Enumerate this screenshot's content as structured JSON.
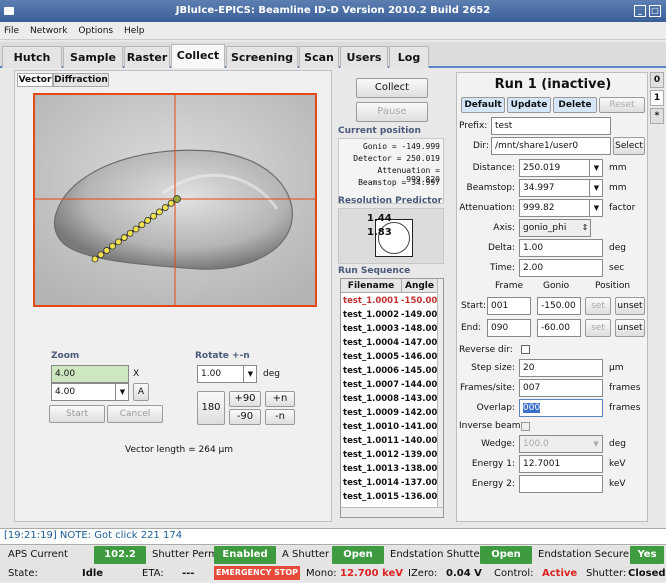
{
  "window": {
    "title": "JBluIce-EPICS: Beamline ID-D Version 2010.2 Build 2652"
  },
  "menu": [
    "File",
    "Network",
    "Options",
    "Help"
  ],
  "tabs": [
    "Hutch",
    "Sample",
    "Raster",
    "Collect",
    "Screening",
    "Scan",
    "Users",
    "Log"
  ],
  "left": {
    "subtabs": [
      "Vector",
      "Diffraction"
    ],
    "zoom": {
      "label": "Zoom",
      "value1": "4.00",
      "unit": "X",
      "value2": "4.00",
      "a_label": "A",
      "start": "Start",
      "cancel": "Cancel"
    },
    "rotate": {
      "label": "Rotate +-n",
      "value": "1.00",
      "unit": "deg",
      "b180": "180",
      "p90": "+90",
      "m90": "-90",
      "pn": "+n",
      "mn": "-n"
    },
    "vector_length": "Vector length = 264 µm"
  },
  "mid": {
    "collect": "Collect",
    "pause": "Pause",
    "current_position": "Current position",
    "pos": [
      "Gonio = -149.999",
      "Detector = 250.019",
      "Attenuation = 999.820",
      "Beamstop = 34.997"
    ],
    "res_title": "Resolution Predictor",
    "res1": "1.44",
    "res2": "1.83",
    "run_seq": "Run Sequence",
    "col_filename": "Filename",
    "col_angle": "Angle",
    "rows": [
      [
        "test_1.0001",
        "-150.00"
      ],
      [
        "test_1.0002",
        "-149.00"
      ],
      [
        "test_1.0003",
        "-148.00"
      ],
      [
        "test_1.0004",
        "-147.00"
      ],
      [
        "test_1.0005",
        "-146.00"
      ],
      [
        "test_1.0006",
        "-145.00"
      ],
      [
        "test_1.0007",
        "-144.00"
      ],
      [
        "test_1.0008",
        "-143.00"
      ],
      [
        "test_1.0009",
        "-142.00"
      ],
      [
        "test_1.0010",
        "-141.00"
      ],
      [
        "test_1.0011",
        "-140.00"
      ],
      [
        "test_1.0012",
        "-139.00"
      ],
      [
        "test_1.0013",
        "-138.00"
      ],
      [
        "test_1.0014",
        "-137.00"
      ],
      [
        "test_1.0015",
        "-136.00"
      ]
    ]
  },
  "run": {
    "title": "Run 1 (inactive)",
    "default": "Default",
    "update": "Update",
    "delete": "Delete",
    "reset": "Reset",
    "side": [
      "0",
      "1",
      "*"
    ],
    "prefix_label": "Prefix:",
    "prefix": "test",
    "dir_label": "Dir:",
    "dir": "/mnt/share1/user0",
    "select": "Select",
    "distance_label": "Distance:",
    "distance": "250.019",
    "distance_unit": "mm",
    "beamstop_label": "Beamstop:",
    "beamstop": "34.997",
    "beamstop_unit": "mm",
    "atten_label": "Attenuation:",
    "atten": "999.82",
    "atten_unit": "factor",
    "axis_label": "Axis:",
    "axis": "gonio_phi",
    "delta_label": "Delta:",
    "delta": "1.00",
    "delta_unit": "deg",
    "time_label": "Time:",
    "time": "2.00",
    "time_unit": "sec",
    "h_frame": "Frame",
    "h_gonio": "Gonio",
    "h_position": "Position",
    "start_label": "Start:",
    "start_frame": "001",
    "start_gonio": "-150.00",
    "set": "set",
    "unset": "unset",
    "end_label": "End:",
    "end_frame": "090",
    "end_gonio": "-60.00",
    "reverse_label": "Reverse dir:",
    "stepsize_label": "Step size:",
    "stepsize": "20",
    "stepsize_unit": "µm",
    "frames_label": "Frames/site:",
    "frames": "007",
    "frames_unit": "frames",
    "overlap_label": "Overlap:",
    "overlap": "000",
    "overlap_unit": "frames",
    "inverse_label": "Inverse beam",
    "wedge_label": "Wedge:",
    "wedge": "100.0",
    "wedge_unit": "deg",
    "e1_label": "Energy 1:",
    "e1": "12.7001",
    "e1_unit": "keV",
    "e2_label": "Energy 2:",
    "e2": "",
    "e2_unit": "keV"
  },
  "log": "[19:21:19] NOTE: Got click 221 174",
  "status1": {
    "aps_label": "APS Current",
    "aps": "102.2",
    "shutter_label": "Shutter Permit",
    "shutter": "Enabled",
    "ashutter_label": "A Shutter",
    "ashutter": "Open",
    "end_label": "Endstation Shutter",
    "end": "Open",
    "secure_label": "Endstation Secure",
    "secure": "Yes"
  },
  "status2": {
    "state_label": "State:",
    "state": "Idle",
    "eta_label": "ETA:",
    "eta": "---",
    "estop": "EMERGENCY STOP",
    "mono_label": "Mono:",
    "mono": "12.700 keV",
    "izero_label": "IZero:",
    "izero": "0.04 V",
    "control_label": "Control:",
    "control": "Active",
    "shutter_label": "Shutter:",
    "shutter": "Closed"
  },
  "colors": {
    "accent": "#5a86c6",
    "green": "#3f9b3f",
    "red": "#d22",
    "crosshair": "#e24a1a",
    "points": "#f2e14a"
  }
}
